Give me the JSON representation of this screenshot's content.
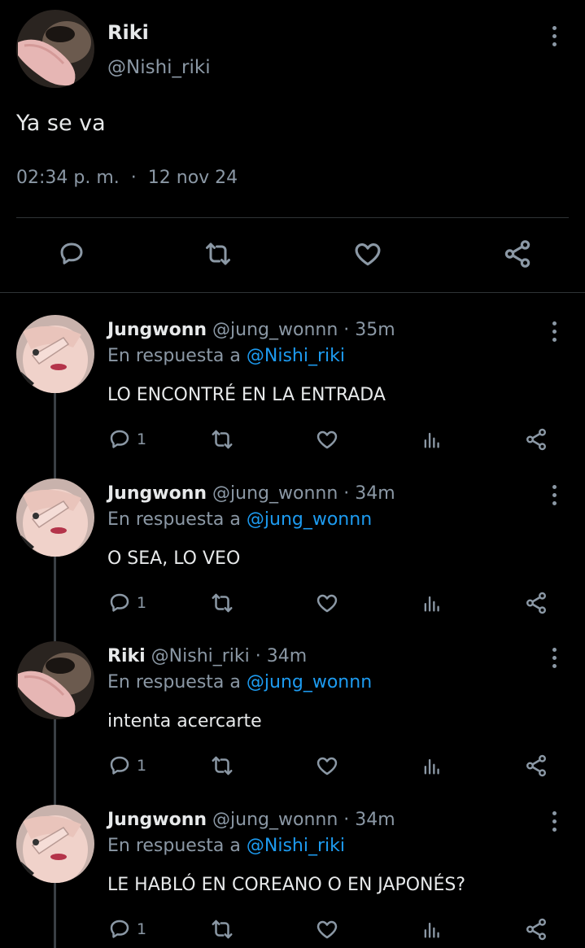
{
  "main_tweet": {
    "name": "Riki",
    "handle": "@Nishi_riki",
    "text": "Ya se va",
    "time": "02:34 p. m.",
    "separator": "·",
    "date": "12 nov 24"
  },
  "replies": [
    {
      "name": "Jungwonn",
      "handle": "@jung_wonnn",
      "dot": "·",
      "time": "35m",
      "in_reply_prefix": "En respuesta a",
      "in_reply_to": "@Nishi_riki",
      "text": "LO ENCONTRÉ EN LA ENTRADA",
      "reply_count": "1"
    },
    {
      "name": "Jungwonn",
      "handle": "@jung_wonnn",
      "dot": "·",
      "time": "34m",
      "in_reply_prefix": "En respuesta a",
      "in_reply_to": "@jung_wonnn",
      "text": "O SEA, LO VEO",
      "reply_count": "1"
    },
    {
      "name": "Riki",
      "handle": "@Nishi_riki",
      "dot": "·",
      "time": "34m",
      "in_reply_prefix": "En respuesta a",
      "in_reply_to": "@jung_wonnn",
      "text": "intenta acercarte",
      "reply_count": "1"
    },
    {
      "name": "Jungwonn",
      "handle": "@jung_wonnn",
      "dot": "·",
      "time": "34m",
      "in_reply_prefix": "En respuesta a",
      "in_reply_to": "@Nishi_riki",
      "text": "LE HABLÓ EN COREANO O EN JAPONÉS?",
      "reply_count": "1"
    }
  ],
  "icons": {
    "reply": "reply-icon",
    "retweet": "retweet-icon",
    "like": "heart-icon",
    "views": "views-icon",
    "share": "share-icon",
    "menu": "more-options-icon"
  },
  "colors": {
    "background": "#000000",
    "text": "#e7e9ea",
    "secondary": "#8b98a5",
    "link": "#1d9bf0"
  }
}
